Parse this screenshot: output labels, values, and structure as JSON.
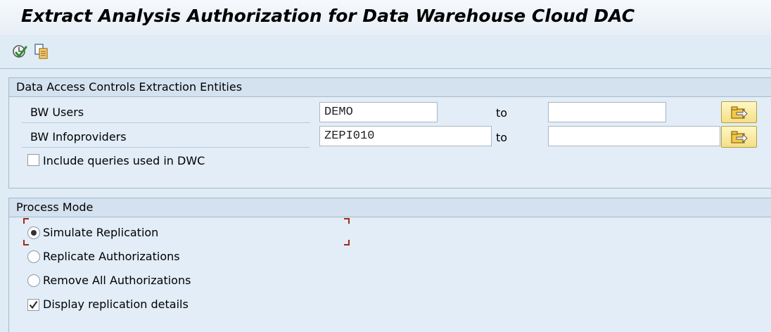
{
  "window": {
    "title": "Extract Analysis Authorization for Data Warehouse Cloud DAC"
  },
  "toolbar": {
    "icons": [
      "execute-icon",
      "variants-icon"
    ]
  },
  "selection_group": {
    "header": "Data Access Controls Extraction Entities",
    "rows": [
      {
        "label": "BW Users",
        "from_value": "DEMO",
        "to_label": "to",
        "to_value": ""
      },
      {
        "label": "BW Infoproviders",
        "from_value": "ZEPI010",
        "to_label": "to",
        "to_value": ""
      }
    ],
    "include_queries": {
      "label": "Include queries used in DWC",
      "checked": false
    }
  },
  "process_mode": {
    "header": "Process Mode",
    "options": [
      {
        "label": "Simulate Replication",
        "selected": true
      },
      {
        "label": "Replicate Authorizations",
        "selected": false
      },
      {
        "label": "Remove All Authorizations",
        "selected": false
      }
    ],
    "display_details": {
      "label": "Display replication details",
      "checked": true
    }
  },
  "colors": {
    "background": "#dfebf5",
    "group_header": "#d4e2ef",
    "focus_marker": "#a0281c",
    "multi_select_button": "#f5df86"
  }
}
